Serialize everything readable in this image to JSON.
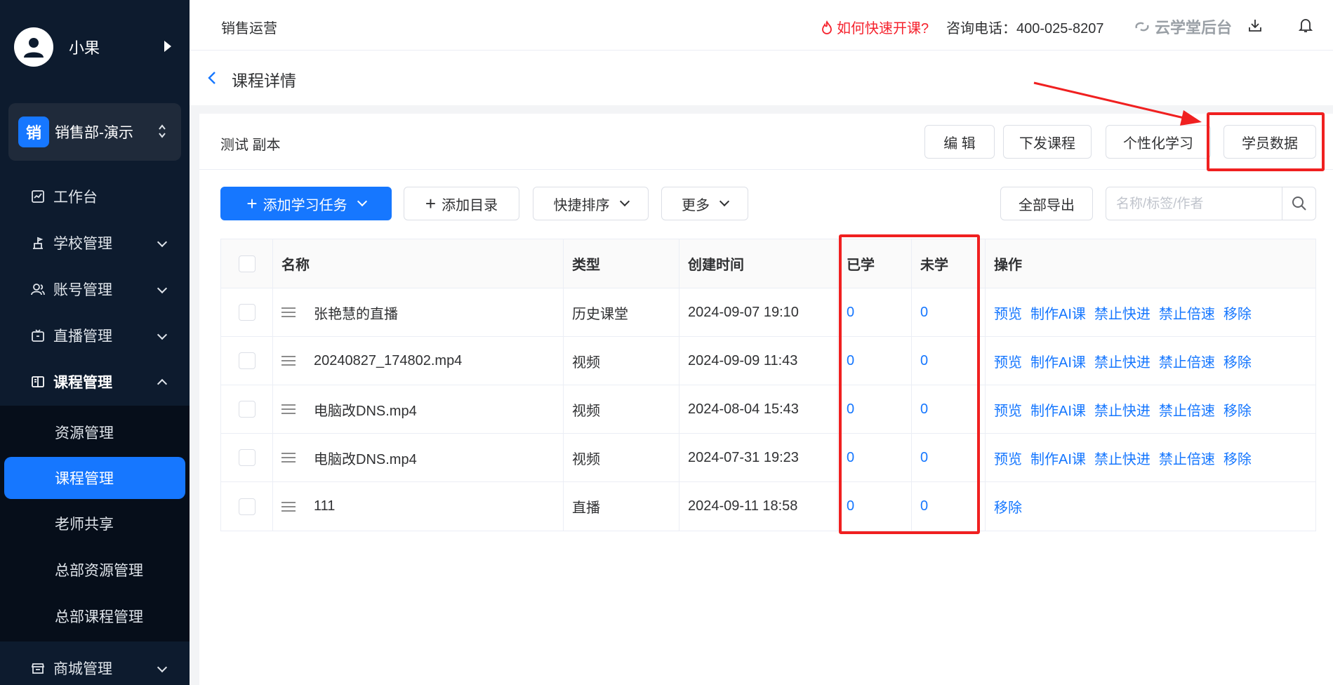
{
  "sidebar": {
    "user_name": "小果",
    "dept_badge": "销",
    "dept_name": "销售部-演示",
    "nav": [
      {
        "label": "工作台"
      },
      {
        "label": "学校管理"
      },
      {
        "label": "账号管理"
      },
      {
        "label": "直播管理"
      },
      {
        "label": "课程管理"
      },
      {
        "label": "商城管理"
      }
    ],
    "sub_nav": [
      {
        "label": "资源管理"
      },
      {
        "label": "课程管理"
      },
      {
        "label": "老师共享"
      },
      {
        "label": "总部资源管理"
      },
      {
        "label": "总部课程管理"
      }
    ]
  },
  "header": {
    "title": "销售运营",
    "howto": "如何快速开课?",
    "phone": "咨询电话：400-025-8207",
    "brand": "云学堂后台"
  },
  "page": {
    "breadcrumb_title": "课程详情",
    "course_name": "测试 副本",
    "head_buttons": {
      "edit": "编 辑",
      "distribute": "下发课程",
      "personalize": "个性化学习",
      "student_data": "学员数据"
    },
    "toolbar": {
      "add_task": "添加学习任务",
      "add_dir": "添加目录",
      "quick_sort": "快捷排序",
      "more": "更多",
      "export_all": "全部导出",
      "search_placeholder": "名称/标签/作者"
    },
    "table": {
      "headers": {
        "name": "名称",
        "type": "类型",
        "created": "创建时间",
        "learned": "已学",
        "unlearned": "未学",
        "ops": "操作"
      },
      "rows": [
        {
          "name": "张艳慧的直播",
          "type": "历史课堂",
          "created": "2024-09-07 19:10",
          "learned": "0",
          "unlearned": "0",
          "ops": [
            "预览",
            "制作AI课",
            "禁止快进",
            "禁止倍速",
            "移除"
          ]
        },
        {
          "name": "20240827_174802.mp4",
          "type": "视频",
          "created": "2024-09-09 11:43",
          "learned": "0",
          "unlearned": "0",
          "ops": [
            "预览",
            "制作AI课",
            "禁止快进",
            "禁止倍速",
            "移除"
          ]
        },
        {
          "name": "电脑改DNS.mp4",
          "type": "视频",
          "created": "2024-08-04 15:43",
          "learned": "0",
          "unlearned": "0",
          "ops": [
            "预览",
            "制作AI课",
            "禁止快进",
            "禁止倍速",
            "移除"
          ]
        },
        {
          "name": "电脑改DNS.mp4",
          "type": "视频",
          "created": "2024-07-31 19:23",
          "learned": "0",
          "unlearned": "0",
          "ops": [
            "预览",
            "制作AI课",
            "禁止快进",
            "禁止倍速",
            "移除"
          ]
        },
        {
          "name": "111",
          "type": "直播",
          "created": "2024-09-11 18:58",
          "learned": "0",
          "unlearned": "0",
          "ops": [
            "移除"
          ]
        }
      ]
    }
  },
  "colors": {
    "primary": "#1677ff",
    "sidebar_bg": "#0d1b2e",
    "annotation_red": "#f02020",
    "danger": "#f5222d"
  }
}
